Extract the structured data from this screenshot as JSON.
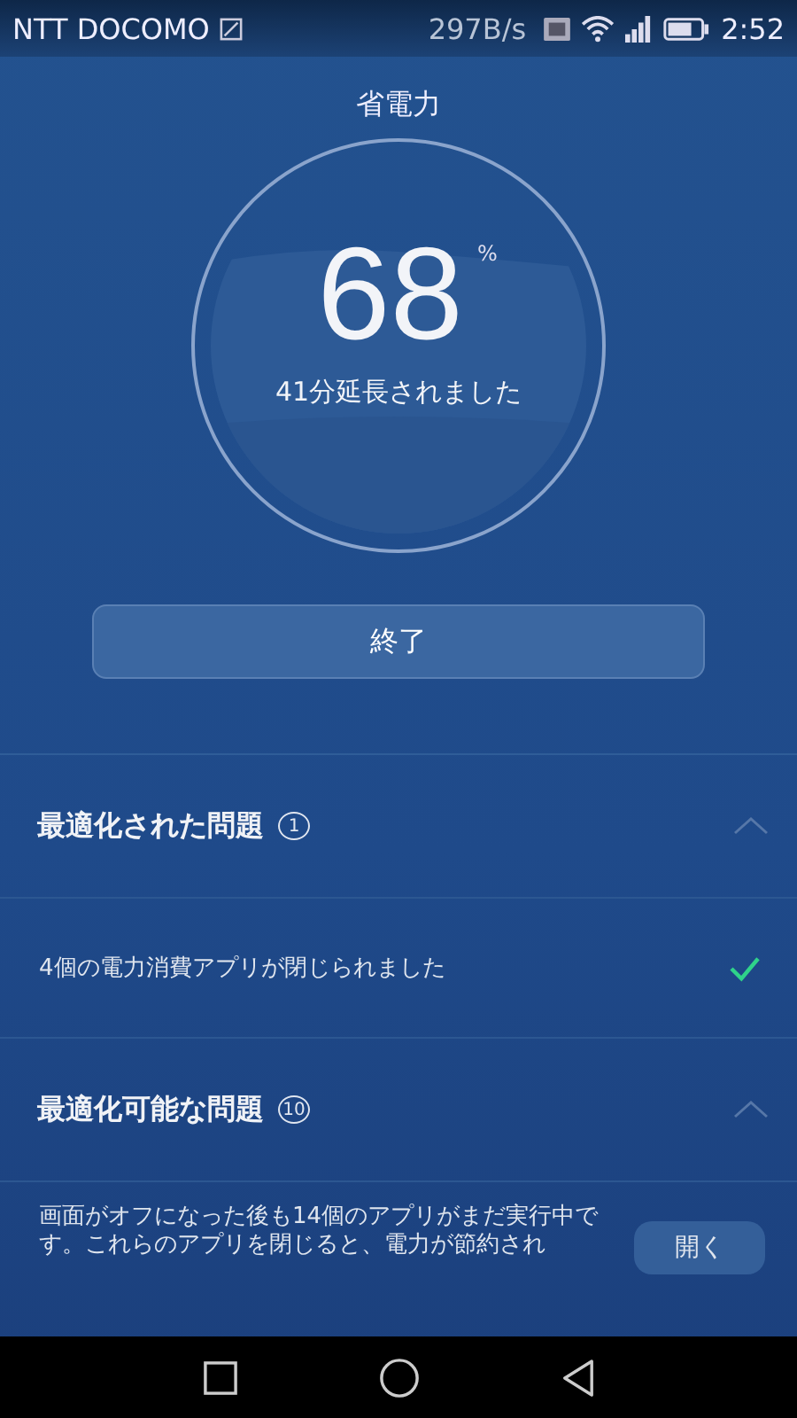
{
  "status_bar": {
    "carrier": "NTT DOCOMO",
    "speed": "297B/s",
    "time": "2:52"
  },
  "title": "省電力",
  "gauge": {
    "value": "68",
    "unit": "%",
    "caption": "41分延長されました"
  },
  "end_button": "終了",
  "sections": [
    {
      "title": "最適化された問題",
      "count": "1",
      "expanded": true,
      "items": [
        {
          "kind": "done",
          "text": "4個の電力消費アプリが閉じられました"
        }
      ]
    },
    {
      "title": "最適化可能な問題",
      "count": "10",
      "expanded": true,
      "items": [
        {
          "kind": "action",
          "text": "画面がオフになった後も14個のアプリがまだ実行中です。これらのアプリを閉じると、電力が節約され",
          "button": "開く"
        }
      ]
    }
  ]
}
